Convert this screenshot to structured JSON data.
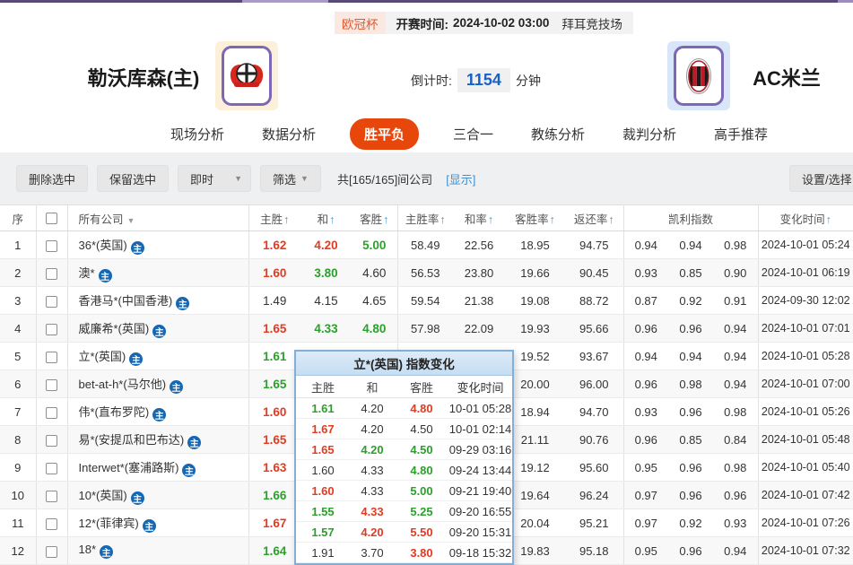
{
  "colors": {
    "accent_orange": "#e8470b",
    "odds_red": "#e23b20",
    "odds_green": "#2aa12a",
    "link_blue": "#3b8fd4",
    "countdown_blue": "#1861c8",
    "topbar_purple": "#584a76"
  },
  "header": {
    "league": "欧冠杯",
    "kickoff_label": "开赛时间:",
    "kickoff_time": "2024-10-02 03:00",
    "venue": "拜耳竞技场",
    "home_team": "勒沃库森(主)",
    "away_team": "AC米兰",
    "countdown_label": "倒计时:",
    "countdown_value": "1154",
    "countdown_unit": "分钟"
  },
  "nav": {
    "tabs": [
      {
        "label": "现场分析",
        "cls": "plain"
      },
      {
        "label": "数据分析",
        "cls": "plain"
      },
      {
        "label": "胜平负",
        "cls": "active"
      },
      {
        "label": "三合一",
        "cls": "plain"
      },
      {
        "label": "教练分析",
        "cls": "plain"
      },
      {
        "label": "裁判分析",
        "cls": "plain"
      },
      {
        "label": "高手推荐",
        "cls": "plain"
      }
    ]
  },
  "toolbar": {
    "delete_selected": "删除选中",
    "keep_selected": "保留选中",
    "live": "即时",
    "filter": "筛选",
    "company_count": "共[165/165]间公司",
    "show_link": "[显示]",
    "settings": "设置/选择"
  },
  "table": {
    "headers": {
      "seq": "序",
      "company": "所有公司",
      "home": "主胜",
      "draw": "和",
      "away": "客胜",
      "home_rate": "主胜率",
      "draw_rate": "和率",
      "away_rate": "客胜率",
      "return_rate": "返还率",
      "kelly": "凯利指数",
      "change_time": "变化时间"
    },
    "rows": [
      {
        "seq": "1",
        "company": "36*(英国)",
        "h": {
          "v": "1.62",
          "s": "red"
        },
        "d": {
          "v": "4.20",
          "s": "red"
        },
        "a": {
          "v": "5.00",
          "s": "green"
        },
        "hr": "58.49",
        "dr": "22.56",
        "ar": "18.95",
        "rr": "94.75",
        "k1": "0.94",
        "k2": "0.94",
        "k3": "0.98",
        "time": "2024-10-01 05:24"
      },
      {
        "seq": "2",
        "company": "澳*",
        "h": {
          "v": "1.60",
          "s": "red"
        },
        "d": {
          "v": "3.80",
          "s": "green"
        },
        "a": {
          "v": "4.60",
          "s": "plain"
        },
        "hr": "56.53",
        "dr": "23.80",
        "ar": "19.66",
        "rr": "90.45",
        "k1": "0.93",
        "k2": "0.85",
        "k3": "0.90",
        "time": "2024-10-01 06:19"
      },
      {
        "seq": "3",
        "company": "香港马*(中国香港)",
        "h": {
          "v": "1.49",
          "s": "plain"
        },
        "d": {
          "v": "4.15",
          "s": "plain"
        },
        "a": {
          "v": "4.65",
          "s": "plain"
        },
        "hr": "59.54",
        "dr": "21.38",
        "ar": "19.08",
        "rr": "88.72",
        "k1": "0.87",
        "k2": "0.92",
        "k3": "0.91",
        "time": "2024-09-30 12:02"
      },
      {
        "seq": "4",
        "company": "威廉希*(英国)",
        "h": {
          "v": "1.65",
          "s": "red"
        },
        "d": {
          "v": "4.33",
          "s": "green"
        },
        "a": {
          "v": "4.80",
          "s": "green"
        },
        "hr": "57.98",
        "dr": "22.09",
        "ar": "19.93",
        "rr": "95.66",
        "k1": "0.96",
        "k2": "0.96",
        "k3": "0.94",
        "time": "2024-10-01 07:01"
      },
      {
        "seq": "5",
        "company": "立*(英国)",
        "h": {
          "v": "1.61",
          "s": "green"
        },
        "d": {
          "v": "",
          "s": "plain"
        },
        "a": {
          "v": "",
          "s": "plain"
        },
        "hr": "",
        "dr": "",
        "ar": "19.52",
        "rr": "93.67",
        "k1": "0.94",
        "k2": "0.94",
        "k3": "0.94",
        "time": "2024-10-01 05:28"
      },
      {
        "seq": "6",
        "company": "bet-at-h*(马尔他)",
        "h": {
          "v": "1.65",
          "s": "green"
        },
        "d": {
          "v": "",
          "s": "plain"
        },
        "a": {
          "v": "",
          "s": "plain"
        },
        "hr": "",
        "dr": "",
        "ar": "20.00",
        "rr": "96.00",
        "k1": "0.96",
        "k2": "0.98",
        "k3": "0.94",
        "time": "2024-10-01 07:00"
      },
      {
        "seq": "7",
        "company": "伟*(直布罗陀)",
        "h": {
          "v": "1.60",
          "s": "red"
        },
        "d": {
          "v": "",
          "s": "plain"
        },
        "a": {
          "v": "",
          "s": "plain"
        },
        "hr": "",
        "dr": "",
        "ar": "18.94",
        "rr": "94.70",
        "k1": "0.93",
        "k2": "0.96",
        "k3": "0.98",
        "time": "2024-10-01 05:26"
      },
      {
        "seq": "8",
        "company": "易*(安提瓜和巴布达)",
        "h": {
          "v": "1.65",
          "s": "red"
        },
        "d": {
          "v": "",
          "s": "plain"
        },
        "a": {
          "v": "",
          "s": "plain"
        },
        "hr": "",
        "dr": "",
        "ar": "21.11",
        "rr": "90.76",
        "k1": "0.96",
        "k2": "0.85",
        "k3": "0.84",
        "time": "2024-10-01 05:48"
      },
      {
        "seq": "9",
        "company": "Interwet*(塞浦路斯)",
        "h": {
          "v": "1.63",
          "s": "red"
        },
        "d": {
          "v": "",
          "s": "plain"
        },
        "a": {
          "v": "",
          "s": "plain"
        },
        "hr": "",
        "dr": "",
        "ar": "19.12",
        "rr": "95.60",
        "k1": "0.95",
        "k2": "0.96",
        "k3": "0.98",
        "time": "2024-10-01 05:40"
      },
      {
        "seq": "10",
        "company": "10*(英国)",
        "h": {
          "v": "1.66",
          "s": "green"
        },
        "d": {
          "v": "",
          "s": "plain"
        },
        "a": {
          "v": "",
          "s": "plain"
        },
        "hr": "",
        "dr": "",
        "ar": "19.64",
        "rr": "96.24",
        "k1": "0.97",
        "k2": "0.96",
        "k3": "0.96",
        "time": "2024-10-01 07:42"
      },
      {
        "seq": "11",
        "company": "12*(菲律宾)",
        "h": {
          "v": "1.67",
          "s": "red"
        },
        "d": {
          "v": "",
          "s": "plain"
        },
        "a": {
          "v": "",
          "s": "plain"
        },
        "hr": "",
        "dr": "",
        "ar": "20.04",
        "rr": "95.21",
        "k1": "0.97",
        "k2": "0.92",
        "k3": "0.93",
        "time": "2024-10-01 07:26"
      },
      {
        "seq": "12",
        "company": "18*",
        "h": {
          "v": "1.64",
          "s": "green"
        },
        "d": {
          "v": "",
          "s": "plain"
        },
        "a": {
          "v": "",
          "s": "plain"
        },
        "hr": "",
        "dr": "",
        "ar": "19.83",
        "rr": "95.18",
        "k1": "0.95",
        "k2": "0.96",
        "k3": "0.94",
        "time": "2024-10-01 07:32"
      }
    ]
  },
  "popup": {
    "title": "立*(英国) 指数变化",
    "headers": [
      "主胜",
      "和",
      "客胜",
      "变化时间"
    ],
    "rows": [
      {
        "h": {
          "v": "1.61",
          "s": "green"
        },
        "d": {
          "v": "4.20",
          "s": "plain"
        },
        "a": {
          "v": "4.80",
          "s": "red"
        },
        "t": "10-01 05:28"
      },
      {
        "h": {
          "v": "1.67",
          "s": "red"
        },
        "d": {
          "v": "4.20",
          "s": "plain"
        },
        "a": {
          "v": "4.50",
          "s": "plain"
        },
        "t": "10-01 02:14"
      },
      {
        "h": {
          "v": "1.65",
          "s": "red"
        },
        "d": {
          "v": "4.20",
          "s": "green"
        },
        "a": {
          "v": "4.50",
          "s": "green"
        },
        "t": "09-29 03:16"
      },
      {
        "h": {
          "v": "1.60",
          "s": "plain"
        },
        "d": {
          "v": "4.33",
          "s": "plain"
        },
        "a": {
          "v": "4.80",
          "s": "green"
        },
        "t": "09-24 13:44"
      },
      {
        "h": {
          "v": "1.60",
          "s": "red"
        },
        "d": {
          "v": "4.33",
          "s": "plain"
        },
        "a": {
          "v": "5.00",
          "s": "green"
        },
        "t": "09-21 19:40"
      },
      {
        "h": {
          "v": "1.55",
          "s": "green"
        },
        "d": {
          "v": "4.33",
          "s": "red"
        },
        "a": {
          "v": "5.25",
          "s": "green"
        },
        "t": "09-20 16:55"
      },
      {
        "h": {
          "v": "1.57",
          "s": "green"
        },
        "d": {
          "v": "4.20",
          "s": "red"
        },
        "a": {
          "v": "5.50",
          "s": "red"
        },
        "t": "09-20 15:31"
      },
      {
        "h": {
          "v": "1.91",
          "s": "plain"
        },
        "d": {
          "v": "3.70",
          "s": "plain"
        },
        "a": {
          "v": "3.80",
          "s": "red"
        },
        "t": "09-18 15:32"
      }
    ]
  }
}
